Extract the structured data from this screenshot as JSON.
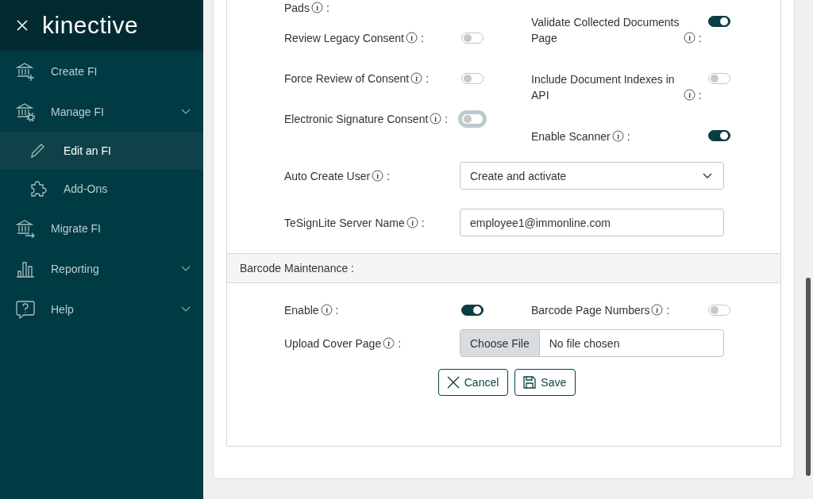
{
  "sidebar": {
    "logo": "kinective",
    "items": [
      {
        "label": "Create FI",
        "selected": false,
        "chevron": false
      },
      {
        "label": "Manage FI",
        "selected": false,
        "chevron": true,
        "children": [
          {
            "label": "Edit an FI",
            "selected": true
          },
          {
            "label": "Add-Ons",
            "selected": false
          }
        ]
      },
      {
        "label": "Migrate FI",
        "selected": false,
        "chevron": false
      },
      {
        "label": "Reporting",
        "selected": false,
        "chevron": true
      },
      {
        "label": "Help",
        "selected": false,
        "chevron": true
      }
    ]
  },
  "settings": {
    "top": {
      "label": "Pads",
      "colon": ":"
    },
    "left_toggles": [
      {
        "label": "Review Legacy Consent",
        "colon": ":",
        "on": false,
        "focused": false
      },
      {
        "label": "Force Review of Consent",
        "colon": ":",
        "on": false,
        "focused": false
      },
      {
        "label": "Electronic Signature Consent",
        "colon": ":",
        "on": false,
        "focused": true
      }
    ],
    "right_toggles": [
      {
        "label": "Validate Collected Documents Page",
        "colon": ":",
        "on": true
      },
      {
        "label": "Include Document Indexes in API",
        "colon": ":",
        "on": false
      },
      {
        "label": "Enable Scanner",
        "colon": ":",
        "on": true
      }
    ],
    "fields": [
      {
        "kind": "select",
        "label": "Auto Create User",
        "colon": ":",
        "value": "Create and activate"
      },
      {
        "kind": "text",
        "label": "TeSignLite Server Name",
        "colon": ":",
        "value": "employee1@immonline.com"
      }
    ]
  },
  "barcode": {
    "title": "Barcode Maintenance :",
    "toggles": [
      {
        "label": "Enable",
        "colon": ":",
        "on": true
      },
      {
        "label": "Barcode Page Numbers",
        "colon": ":",
        "on": false
      }
    ],
    "fields": [
      {
        "kind": "file",
        "label": "Upload Cover Page",
        "colon": ":",
        "button": "Choose File",
        "value": "No file chosen"
      }
    ]
  },
  "buttons": [
    {
      "kind": "cancel",
      "label": "Cancel"
    },
    {
      "kind": "save",
      "label": "Save"
    }
  ]
}
